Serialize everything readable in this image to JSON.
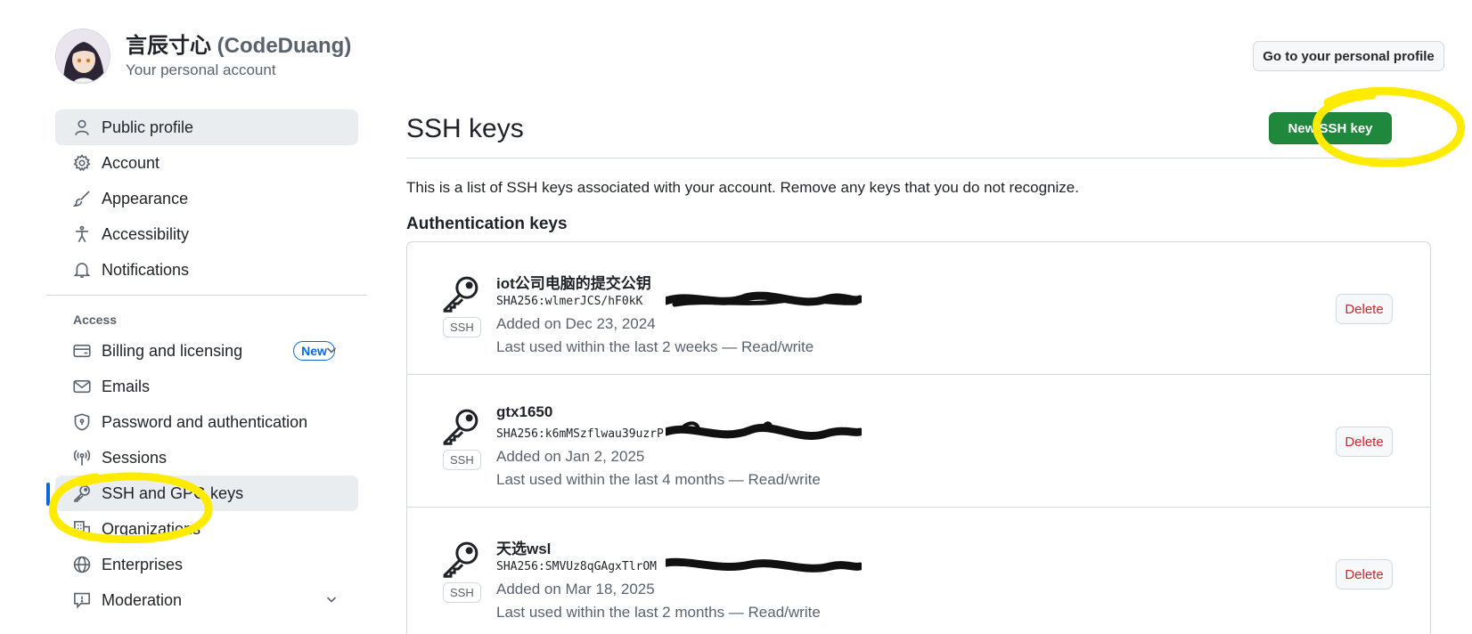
{
  "user": {
    "display_name": "言辰寸心",
    "login": "(CodeDuang)",
    "subtitle": "Your personal account",
    "profile_button": "Go to your personal profile"
  },
  "sidebar": {
    "items": [
      {
        "label": "Public profile",
        "icon": "person-icon"
      },
      {
        "label": "Account",
        "icon": "gear-icon"
      },
      {
        "label": "Appearance",
        "icon": "paintbrush-icon"
      },
      {
        "label": "Accessibility",
        "icon": "accessibility-icon"
      },
      {
        "label": "Notifications",
        "icon": "bell-icon"
      }
    ],
    "access_heading": "Access",
    "access_items": [
      {
        "label": "Billing and licensing",
        "icon": "credit-card-icon",
        "badge": "New"
      },
      {
        "label": "Emails",
        "icon": "mail-icon"
      },
      {
        "label": "Password and authentication",
        "icon": "shield-lock-icon"
      },
      {
        "label": "Sessions",
        "icon": "broadcast-icon"
      },
      {
        "label": "SSH and GPG keys",
        "icon": "key-icon"
      },
      {
        "label": "Organizations",
        "icon": "organization-icon"
      },
      {
        "label": "Enterprises",
        "icon": "globe-icon"
      },
      {
        "label": "Moderation",
        "icon": "report-icon"
      }
    ]
  },
  "main": {
    "title": "SSH keys",
    "new_button": "New SSH key",
    "description": "This is a list of SSH keys associated with your account. Remove any keys that you do not recognize.",
    "section_title": "Authentication keys",
    "keys": [
      {
        "name": "iot公司电脑的提交公钥",
        "fingerprint": "SHA256:wlmerJCS/hF0kK",
        "added": "Added on Dec 23, 2024",
        "last_used": "Last used within the last 2 weeks — Read/write",
        "tag": "SSH",
        "delete": "Delete"
      },
      {
        "name": "gtx1650",
        "fingerprint": "SHA256:k6mMSzflwau39uzrP",
        "added": "Added on Jan 2, 2025",
        "last_used": "Last used within the last 4 months — Read/write",
        "tag": "SSH",
        "delete": "Delete"
      },
      {
        "name": "天选wsl",
        "fingerprint": "SHA256:SMVUz8qGAgxTlrOM",
        "added": "Added on Mar 18, 2025",
        "last_used": "Last used within the last 2 months — Read/write",
        "tag": "SSH",
        "delete": "Delete"
      }
    ]
  },
  "colors": {
    "accent": "#0969da",
    "primary_button": "#1f883d",
    "danger": "#d1242f",
    "highlight": "#ffeb00"
  }
}
